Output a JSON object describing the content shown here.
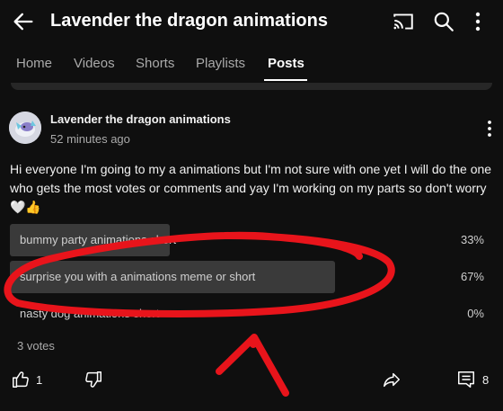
{
  "header": {
    "title": "Lavender the dragon animations",
    "back_icon": "arrow-left-icon",
    "cast_icon": "cast-icon",
    "search_icon": "search-icon",
    "more_icon": "more-vertical-icon"
  },
  "tabs": [
    {
      "label": "Home"
    },
    {
      "label": "Videos"
    },
    {
      "label": "Shorts"
    },
    {
      "label": "Playlists"
    },
    {
      "label": "Posts",
      "active": true
    }
  ],
  "post": {
    "author": "Lavender the dragon animations",
    "time": "52 minutes ago",
    "text": "Hi everyone I'm going to my a animations but I'm not sure with one yet I will do the one who gets the most votes or comments and yay I'm working on my parts so don't worry 🤍👍",
    "poll": {
      "options": [
        {
          "label": "bummy party animations short",
          "percent": "33%",
          "fraction": 0.33
        },
        {
          "label": "surprise you with a animations meme or short",
          "percent": "67%",
          "fraction": 0.67
        },
        {
          "label": "nasty dog animations short",
          "percent": "0%",
          "fraction": 0.0
        }
      ],
      "votes": "3 votes"
    },
    "actions": {
      "like_count": "1",
      "comment_count": "8"
    }
  },
  "colors": {
    "background": "#0f0f0f",
    "poll_fill": "#3a3a3a",
    "annotation": "#e8141b"
  }
}
